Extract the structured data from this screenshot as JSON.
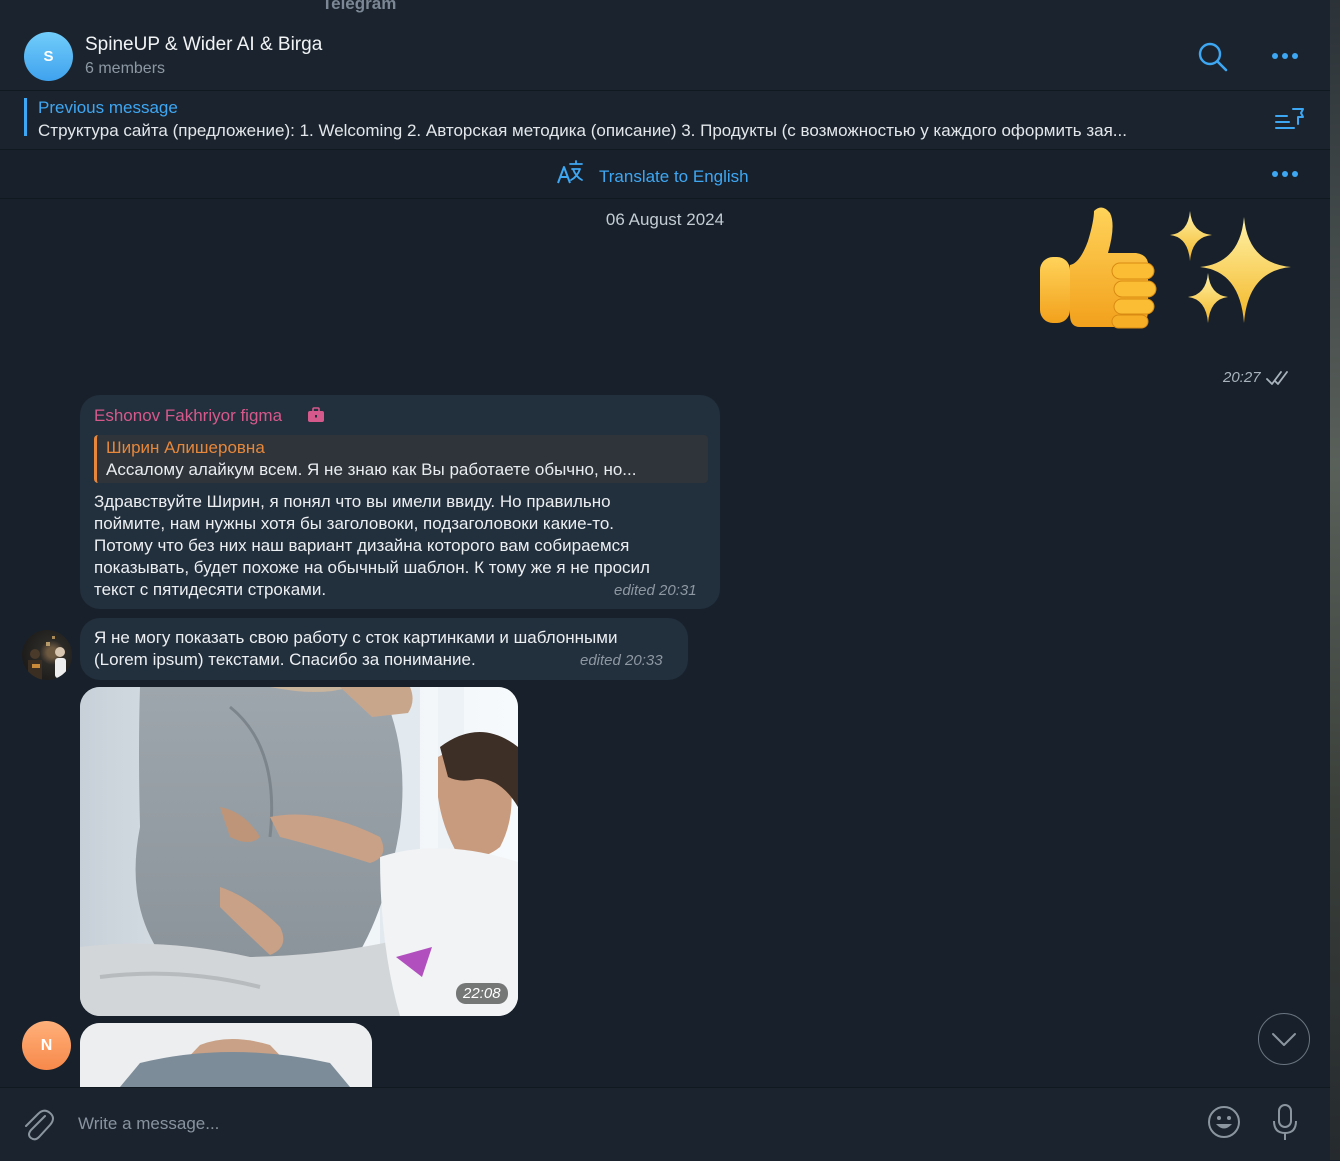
{
  "window": {
    "title": "Telegram"
  },
  "header": {
    "avatar_letter": "S",
    "title": "SpineUP & Wider AI & Birga",
    "subtitle": "6 members",
    "icons": [
      "search-icon",
      "more-icon"
    ]
  },
  "pinned": {
    "label": "Previous message",
    "text": "Структура сайта (предложение):   1. Welcoming  2. Авторская методика (описание)  3. Продукты (с возможностью у каждого оформить зая..."
  },
  "translate_bar": {
    "label": "Translate to English"
  },
  "date_separator": "06 August 2024",
  "messages": [
    {
      "type": "sticker",
      "emoji": "👍✨",
      "time": "20:27",
      "outgoing": true
    },
    {
      "type": "text",
      "sender": "Eshonov Fakhriyor figma",
      "reply": {
        "name": "Ширин Алишеровна",
        "text": "Ассалому алайкум всем. Я не знаю как Вы работаете обычно, но..."
      },
      "lines": [
        "Здравствуйте Ширин, я понял что вы имели ввиду. Но правильно",
        "поймите, нам нужны хотя бы заголовоки, подзаголовоки какие-то.",
        "Потому что без них наш вариант дизайна которого вам собираемся",
        "показывать, будет похоже на обычный шаблон. К тому же я не просил",
        "текст с пятидесяти строками."
      ],
      "meta": "edited 20:31"
    },
    {
      "type": "text",
      "lines": [
        "Я не могу показать свою работу с сток картинками и шаблонными",
        "(Lorem ipsum) текстами. Спасибо за понимание."
      ],
      "meta": "edited 20:33"
    },
    {
      "type": "photo",
      "description_icon": "photo-back-exam",
      "time": "22:08"
    },
    {
      "type": "photo",
      "avatar_letter": "N",
      "partial": true
    }
  ],
  "composer": {
    "placeholder": "Write a message..."
  },
  "colors": {
    "accent": "#3ea7f3",
    "sender_name": "#d6598c",
    "reply_accent": "#e6873b",
    "bubble": "#222f3c",
    "background": "#18212b"
  }
}
